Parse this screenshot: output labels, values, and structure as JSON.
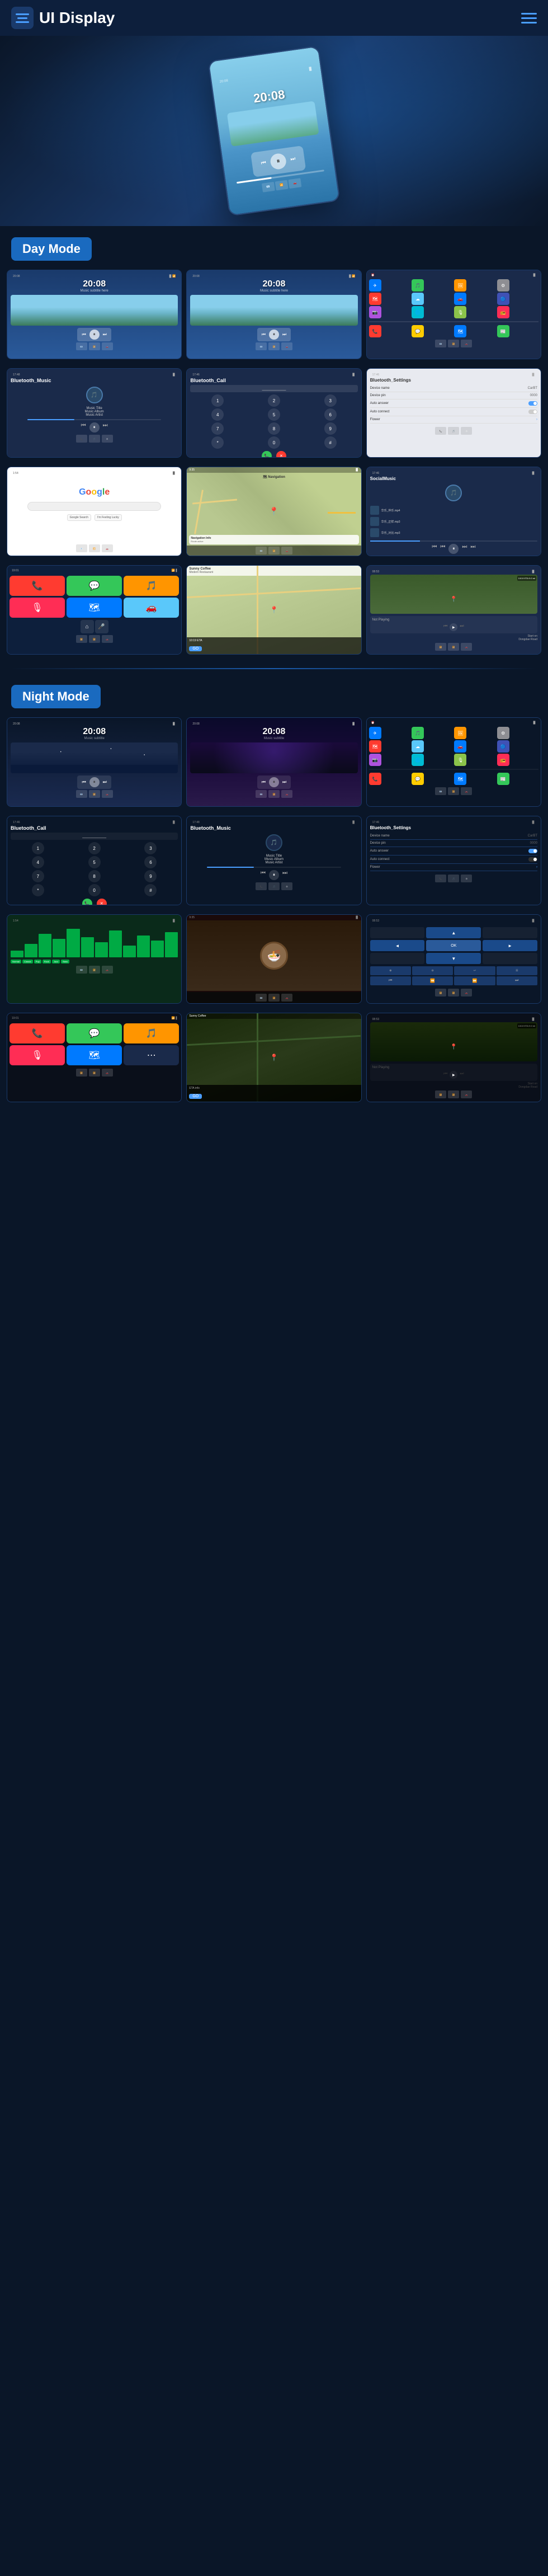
{
  "header": {
    "title": "UI Display",
    "menu_label": "Menu"
  },
  "sections": {
    "day_mode_label": "Day Mode",
    "night_mode_label": "Night Mode"
  },
  "screenshots": {
    "music_title": "Music Title",
    "music_album": "Music Album",
    "music_artist": "Music Artist",
    "time": "20:08",
    "bluetooth_music": "Bluetooth_Music",
    "bluetooth_call": "Bluetooth_Call",
    "bluetooth_settings": "Bluetooth_Settings",
    "device_name_label": "Device name",
    "device_name_val": "CarBT",
    "device_pin_label": "Device pin",
    "device_pin_val": "0000",
    "auto_answer_label": "Auto answer",
    "auto_connect_label": "Auto connect",
    "flower_label": "Flower",
    "social_music": "SocialMusic",
    "not_playing": "Not Playing",
    "sunny_coffee": "Sunny Coffee",
    "modern_restaurant": "Modern Restaurant",
    "start_on": "Start on",
    "donglue_road": "Dongdae Road",
    "eta_label": "10/19 ETA  9.0 mi",
    "go_label": "GO",
    "eta2_label": "10:19 ETA"
  },
  "nav": {
    "dial_numbers": [
      "1",
      "2",
      "3",
      "4",
      "5",
      "6",
      "7",
      "8",
      "9",
      "*",
      "0",
      "#"
    ]
  },
  "app_icons": {
    "phone": "📞",
    "music": "🎵",
    "maps": "🗺",
    "settings": "⚙",
    "messages": "💬",
    "camera": "📷",
    "browser": "🌐",
    "radio": "📻",
    "podcast": "🎙",
    "weather": "☁",
    "news": "📰",
    "appstore": "🅐"
  }
}
